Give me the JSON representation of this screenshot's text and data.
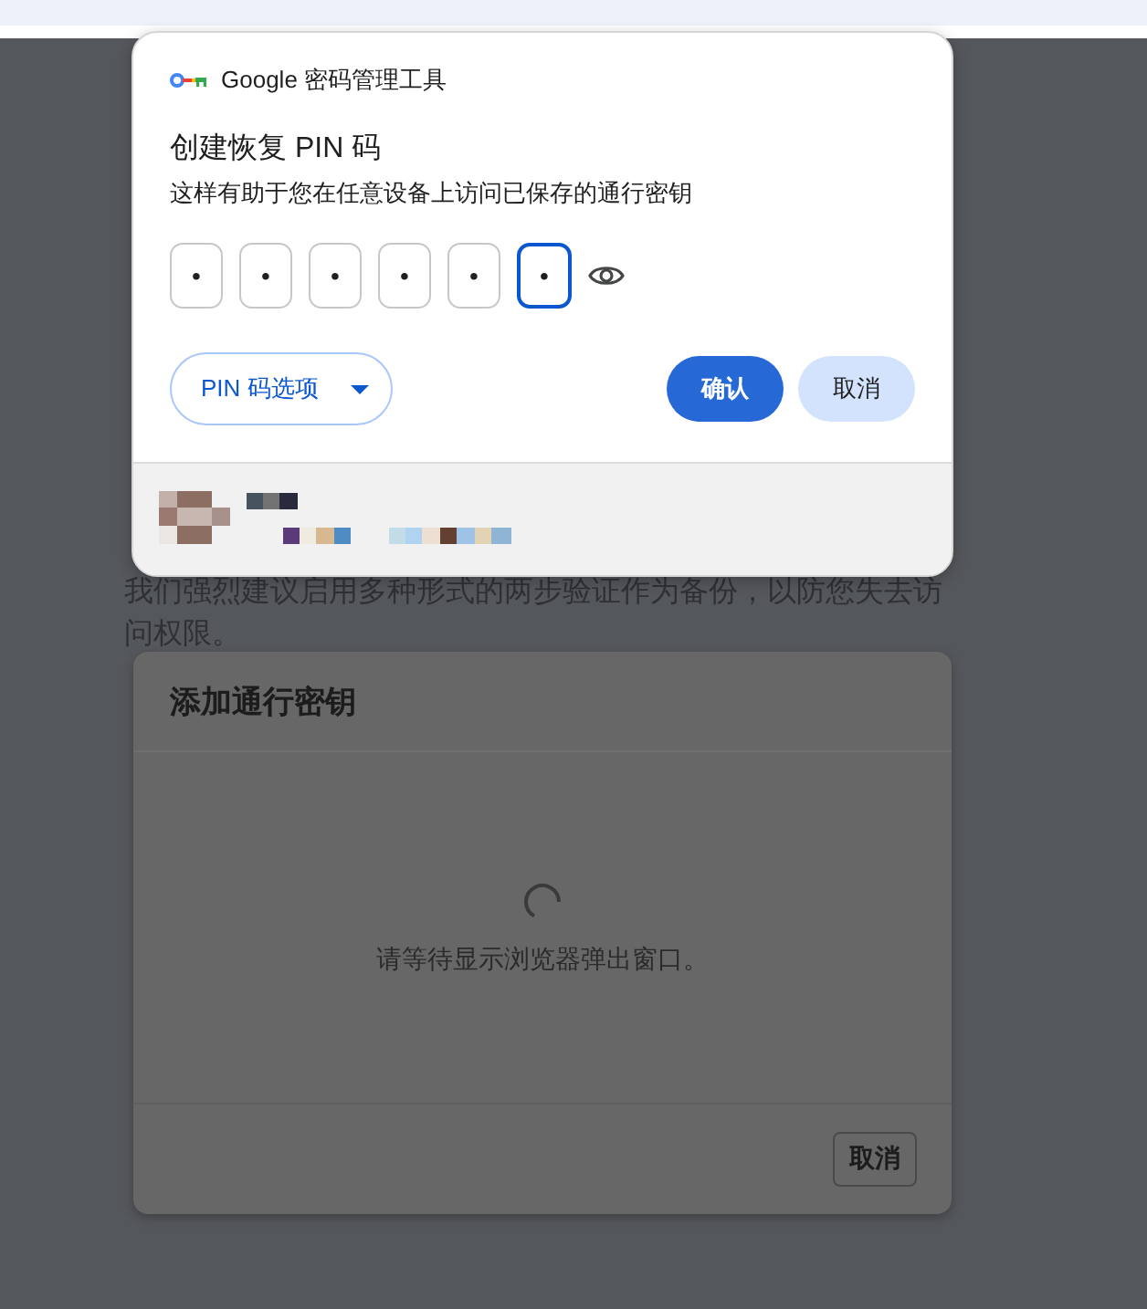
{
  "page": {
    "paragraph": "我们强烈建议启用多种形式的两步验证作为备份，以防您失去访问权限。"
  },
  "dialog": {
    "title": "添加通行密钥",
    "message": "请等待显示浏览器弹出窗口。",
    "cancel_button": "取消"
  },
  "password_popup": {
    "app_name": "Google 密码管理工具",
    "title": "创建恢复 PIN 码",
    "subtitle": "这样有助于您在任意设备上访问已保存的通行密钥",
    "pin_digits": [
      {
        "mask": "•",
        "focused": false
      },
      {
        "mask": "•",
        "focused": false
      },
      {
        "mask": "•",
        "focused": false
      },
      {
        "mask": "•",
        "focused": false
      },
      {
        "mask": "•",
        "focused": false
      },
      {
        "mask": "•",
        "focused": true
      }
    ],
    "options_button": "PIN 码选项",
    "buttons": [
      {
        "label": "确认",
        "kind": "primary"
      },
      {
        "label": "取消",
        "kind": "tonal"
      }
    ]
  }
}
